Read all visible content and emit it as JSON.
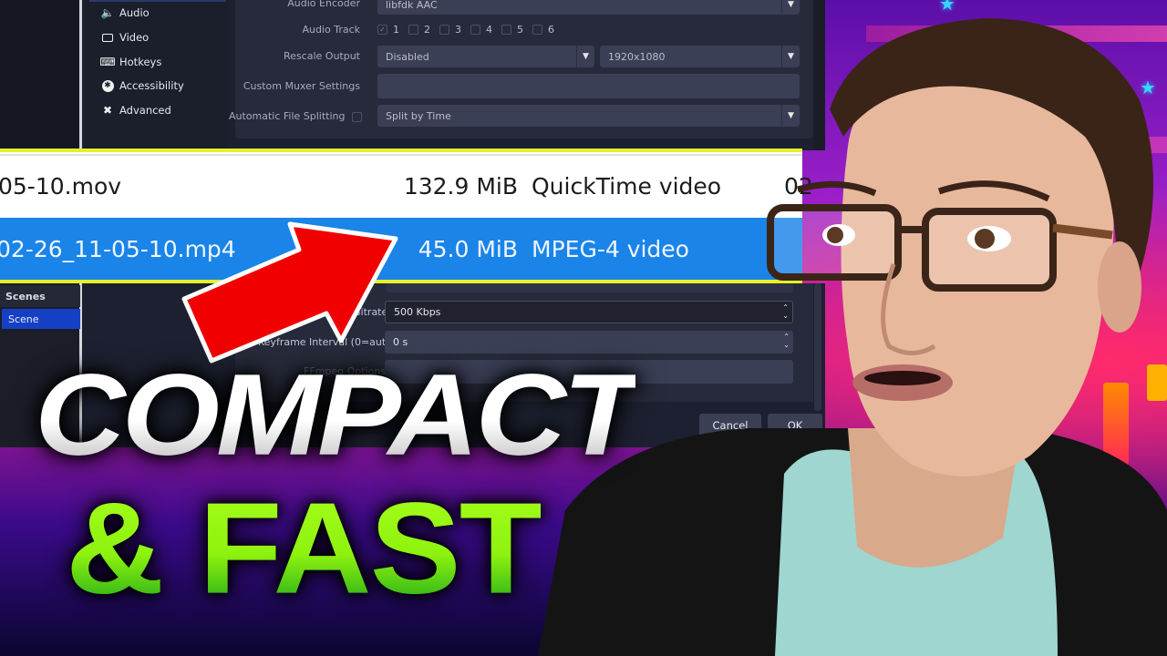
{
  "settings": {
    "nav_items": [
      {
        "label": "Audio",
        "icon": "speaker-icon"
      },
      {
        "label": "Video",
        "icon": "monitor-icon"
      },
      {
        "label": "Hotkeys",
        "icon": "keyboard-icon"
      },
      {
        "label": "Accessibility",
        "icon": "accessibility-icon"
      },
      {
        "label": "Advanced",
        "icon": "wrench-icon"
      }
    ],
    "audio_encoder_label": "Audio Encoder",
    "audio_encoder_value": "libfdk AAC",
    "audio_track_label": "Audio Track",
    "audio_tracks": [
      {
        "n": "1",
        "checked": true
      },
      {
        "n": "2",
        "checked": false
      },
      {
        "n": "3",
        "checked": false
      },
      {
        "n": "4",
        "checked": false
      },
      {
        "n": "5",
        "checked": false
      },
      {
        "n": "6",
        "checked": false
      }
    ],
    "rescale_label": "Rescale Output",
    "rescale_value": "Disabled",
    "rescale_resolution": "1920x1080",
    "muxer_label": "Custom Muxer Settings",
    "muxer_value": "",
    "split_label": "Automatic File Splitting",
    "split_value": "Split by Time",
    "bitrate_label": "Bitrate",
    "bitrate_value": "500 Kbps",
    "keyframe_label": "Keyframe Interval (0=auto)",
    "keyframe_value": "0 s",
    "ffmpeg_label": "FFmpeg Options",
    "ffmpeg_value": "",
    "cancel_label": "Cancel",
    "ok_label": "OK"
  },
  "scenes": {
    "title": "Scenes",
    "items": [
      "Scene"
    ]
  },
  "files": [
    {
      "name": "05-10.mov",
      "size": "132.9 MiB",
      "type": "QuickTime video",
      "date": "02",
      "selected": false
    },
    {
      "name": "02-26_11-05-10.mp4",
      "size": "45.0 MiB",
      "type": "MPEG-4 video",
      "date": "",
      "selected": true
    }
  ],
  "headline": {
    "line1": "COMPACT",
    "line2": "& FAST"
  },
  "colors": {
    "highlight_yellow": "#e5f12a",
    "selection_blue": "#1a84e8",
    "arrow_red": "#f00000",
    "headline_green": "#8ef20f",
    "scene_selected": "#1540c4"
  }
}
